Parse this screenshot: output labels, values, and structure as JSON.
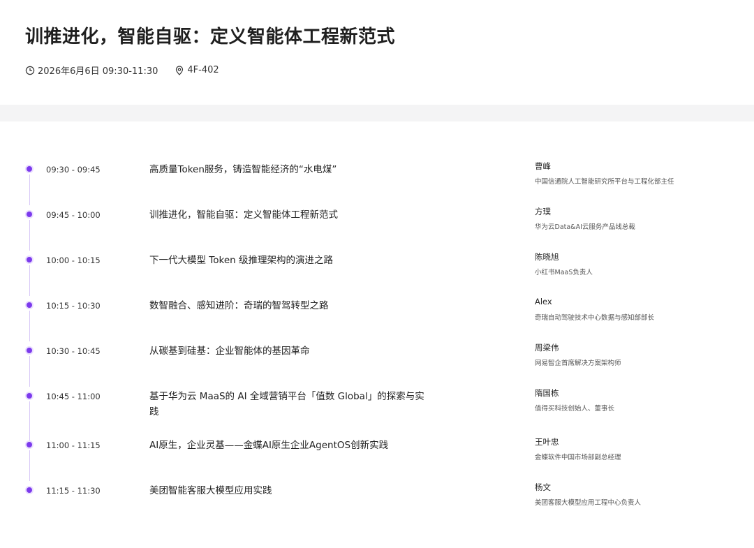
{
  "header": {
    "title": "训推进化，智能自驱：定义智能体工程新范式",
    "datetime": "2026年6月6日 09:30-11:30",
    "location": "4F-402",
    "clock_icon": "clock-icon",
    "location_icon": "location-pin-icon"
  },
  "colors": {
    "accent": "#7c3aed",
    "timeline": "#d7c7f7",
    "band": "#f4f4f5"
  },
  "agenda": [
    {
      "time": "09:30 - 09:45",
      "topic": "高质量Token服务，铸造智能经济的“水电煤”",
      "speaker": "曹峰",
      "role": "中国信通院人工智能研究所平台与工程化部主任"
    },
    {
      "time": "09:45 - 10:00",
      "topic": "训推进化，智能自驱：定义智能体工程新范式",
      "speaker": "方璞",
      "role": "华为云Data&AI云服务产品线总裁"
    },
    {
      "time": "10:00 - 10:15",
      "topic": "下一代大模型 Token 级推理架构的演进之路",
      "speaker": "陈晓旭",
      "role": "小红书MaaS负责人"
    },
    {
      "time": "10:15 - 10:30",
      "topic": "数智融合、感知进阶：奇瑞的智驾转型之路",
      "speaker": "Alex",
      "role": "奇瑞自动驾驶技术中心数据与感知部部长"
    },
    {
      "time": "10:30 - 10:45",
      "topic": "从碳基到硅基：企业智能体的基因革命",
      "speaker": "周梁伟",
      "role": "网易智企首席解决方案架构师"
    },
    {
      "time": "10:45 - 11:00",
      "topic": "基于华为云 MaaS的 AI 全域营销平台「值数 Global」的探索与实践",
      "speaker": "隋国栋",
      "role": "值得买科技创始人、董事长"
    },
    {
      "time": "11:00 - 11:15",
      "topic": "AI原生，企业灵基——金蝶AI原生企业AgentOS创新实践",
      "speaker": "王叶忠",
      "role": "金蝶软件中国市场部副总经理"
    },
    {
      "time": "11:15 - 11:30",
      "topic": "美团智能客服大模型应用实践",
      "speaker": "杨文",
      "role": "美团客服大模型应用工程中心负责人"
    }
  ]
}
